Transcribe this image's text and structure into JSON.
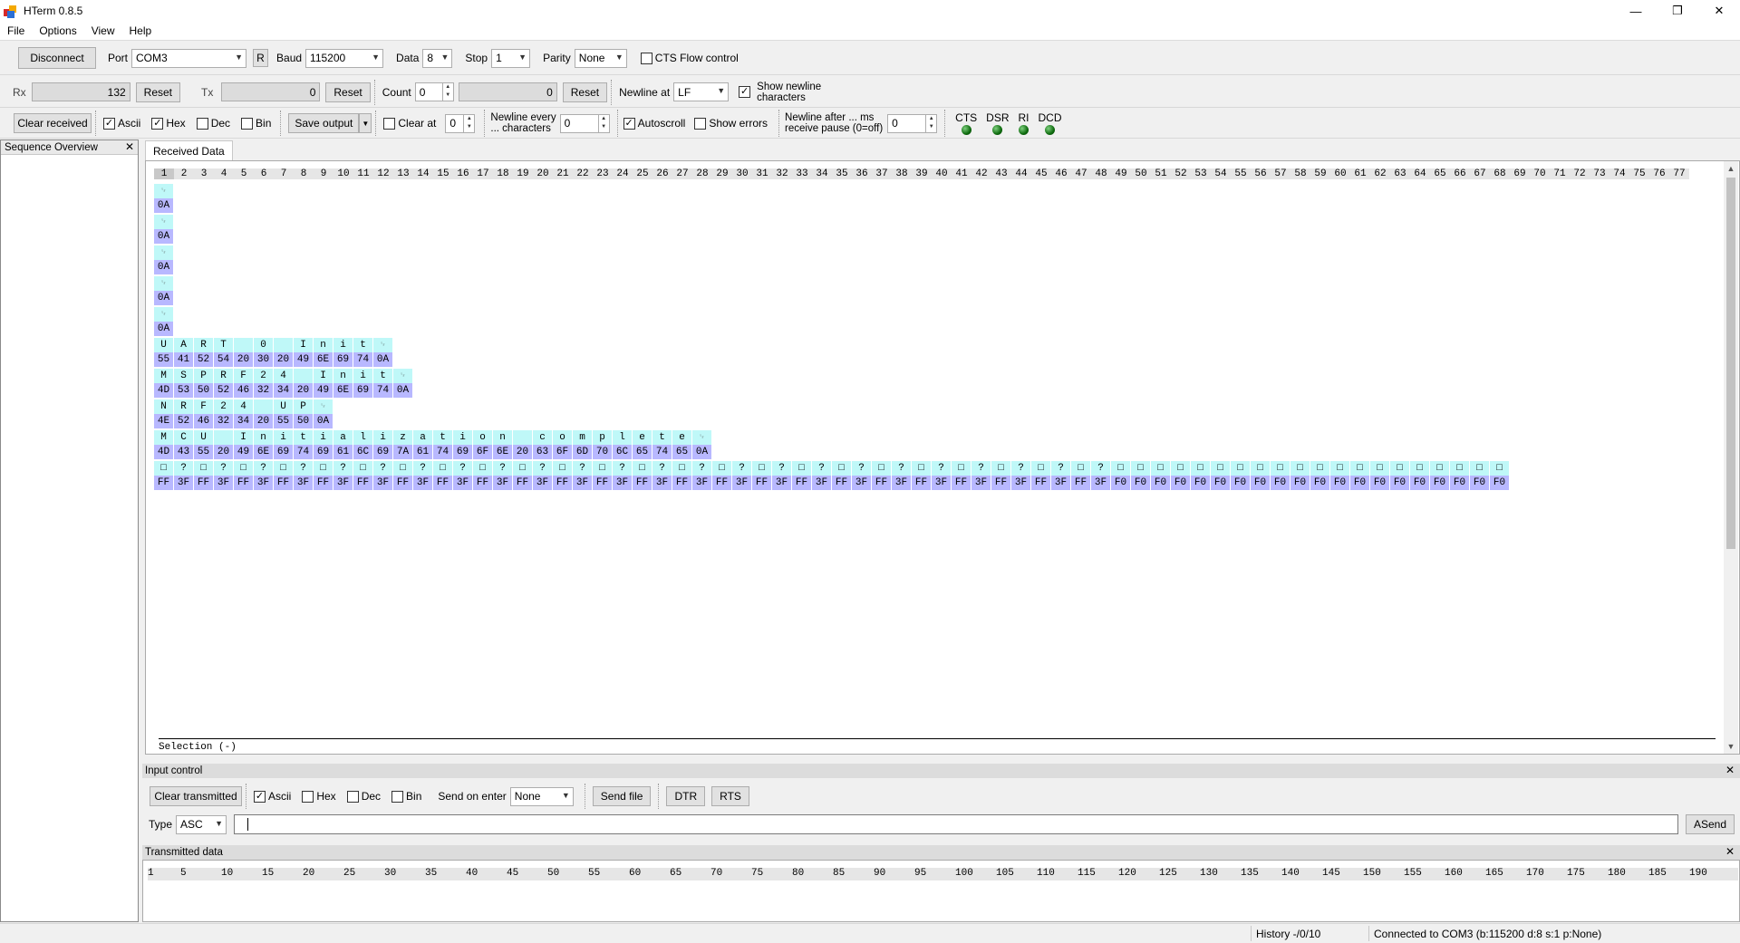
{
  "window": {
    "title": "HTerm 0.8.5"
  },
  "menu": [
    "File",
    "Options",
    "View",
    "Help"
  ],
  "connection": {
    "disconnect_label": "Disconnect",
    "port_label": "Port",
    "port_value": "COM3",
    "r_label": "R",
    "baud_label": "Baud",
    "baud_value": "115200",
    "data_label": "Data",
    "data_value": "8",
    "stop_label": "Stop",
    "stop_value": "1",
    "parity_label": "Parity",
    "parity_value": "None",
    "cts_label": "CTS Flow control"
  },
  "counters": {
    "rx_label": "Rx",
    "rx_value": "132",
    "rx_reset": "Reset",
    "tx_label": "Tx",
    "tx_value": "0",
    "tx_reset": "Reset",
    "count_label": "Count",
    "count_value": "0",
    "count_field": "0",
    "count_reset": "Reset",
    "newline_label": "Newline at",
    "newline_value": "LF",
    "show_newline_line1": "Show newline",
    "show_newline_line2": "characters"
  },
  "display": {
    "clear_received": "Clear received",
    "ascii": "Ascii",
    "hex": "Hex",
    "dec": "Dec",
    "bin": "Bin",
    "save_output": "Save output",
    "clear_at": "Clear at",
    "clear_at_value": "0",
    "newline_every_line1": "Newline every",
    "newline_every_line2": "... characters",
    "newline_every_value": "0",
    "autoscroll": "Autoscroll",
    "show_errors": "Show errors",
    "newline_after_line1": "Newline after ... ms",
    "newline_after_line2": "receive pause (0=off)",
    "newline_after_value": "0",
    "leds": [
      "CTS",
      "DSR",
      "RI",
      "DCD"
    ]
  },
  "sequence": {
    "title": "Sequence Overview"
  },
  "received": {
    "tab": "Received Data",
    "columns": 77,
    "newline_glyph": "␊",
    "rows": [
      {
        "ascii": [
          "␊"
        ],
        "hex": [
          "0A"
        ]
      },
      {
        "ascii": [
          "␊"
        ],
        "hex": [
          "0A"
        ]
      },
      {
        "ascii": [
          "␊"
        ],
        "hex": [
          "0A"
        ]
      },
      {
        "ascii": [
          "␊"
        ],
        "hex": [
          "0A"
        ]
      },
      {
        "ascii": [
          "␊"
        ],
        "hex": [
          "0A"
        ]
      },
      {
        "ascii": [
          "U",
          "A",
          "R",
          "T",
          " ",
          "0",
          " ",
          "I",
          "n",
          "i",
          "t",
          "␊"
        ],
        "hex": [
          "55",
          "41",
          "52",
          "54",
          "20",
          "30",
          "20",
          "49",
          "6E",
          "69",
          "74",
          "0A"
        ]
      },
      {
        "ascii": [
          "M",
          "S",
          "P",
          "R",
          "F",
          "2",
          "4",
          " ",
          "I",
          "n",
          "i",
          "t",
          "␊"
        ],
        "hex": [
          "4D",
          "53",
          "50",
          "52",
          "46",
          "32",
          "34",
          "20",
          "49",
          "6E",
          "69",
          "74",
          "0A"
        ]
      },
      {
        "ascii": [
          "N",
          "R",
          "F",
          "2",
          "4",
          " ",
          "U",
          "P",
          "␊"
        ],
        "hex": [
          "4E",
          "52",
          "46",
          "32",
          "34",
          "20",
          "55",
          "50",
          "0A"
        ]
      },
      {
        "ascii": [
          "M",
          "C",
          "U",
          " ",
          "I",
          "n",
          "i",
          "t",
          "i",
          "a",
          "l",
          "i",
          "z",
          "a",
          "t",
          "i",
          "o",
          "n",
          " ",
          "c",
          "o",
          "m",
          "p",
          "l",
          "e",
          "t",
          "e",
          "␊"
        ],
        "hex": [
          "4D",
          "43",
          "55",
          "20",
          "49",
          "6E",
          "69",
          "74",
          "69",
          "61",
          "6C",
          "69",
          "7A",
          "61",
          "74",
          "69",
          "6F",
          "6E",
          "20",
          "63",
          "6F",
          "6D",
          "70",
          "6C",
          "65",
          "74",
          "65",
          "0A"
        ]
      },
      {
        "ascii": [
          "□",
          "?",
          "□",
          "?",
          "□",
          "?",
          "□",
          "?",
          "□",
          "?",
          "□",
          "?",
          "□",
          "?",
          "□",
          "?",
          "□",
          "?",
          "□",
          "?",
          "□",
          "?",
          "□",
          "?",
          "□",
          "?",
          "□",
          "?",
          "□",
          "?",
          "□",
          "?",
          "□",
          "?",
          "□",
          "?",
          "□",
          "?",
          "□",
          "?",
          "□",
          "?",
          "□",
          "?",
          "□",
          "?",
          "□",
          "?",
          "□",
          "□",
          "□",
          "□",
          "□",
          "□",
          "□",
          "□",
          "□",
          "□",
          "□",
          "□",
          "□",
          "□",
          "□",
          "□",
          "□",
          "□",
          "□",
          "□"
        ],
        "hex": [
          "FF",
          "3F",
          "FF",
          "3F",
          "FF",
          "3F",
          "FF",
          "3F",
          "FF",
          "3F",
          "FF",
          "3F",
          "FF",
          "3F",
          "FF",
          "3F",
          "FF",
          "3F",
          "FF",
          "3F",
          "FF",
          "3F",
          "FF",
          "3F",
          "FF",
          "3F",
          "FF",
          "3F",
          "FF",
          "3F",
          "FF",
          "3F",
          "FF",
          "3F",
          "FF",
          "3F",
          "FF",
          "3F",
          "FF",
          "3F",
          "FF",
          "3F",
          "FF",
          "3F",
          "FF",
          "3F",
          "FF",
          "3F",
          "F0",
          "F0",
          "F0",
          "F0",
          "F0",
          "F0",
          "F0",
          "F0",
          "F0",
          "F0",
          "F0",
          "F0",
          "F0",
          "F0",
          "F0",
          "F0",
          "F0",
          "F0",
          "F0",
          "F0"
        ]
      }
    ],
    "selection": "Selection (-)"
  },
  "input_control": {
    "title": "Input control",
    "clear_transmitted": "Clear transmitted",
    "ascii": "Ascii",
    "hex": "Hex",
    "dec": "Dec",
    "bin": "Bin",
    "send_on_enter_label": "Send on enter",
    "send_on_enter_value": "None",
    "send_file": "Send file",
    "dtr": "DTR",
    "rts": "RTS",
    "type_label": "Type",
    "type_value": "ASC",
    "send_input_value": "",
    "asend": "ASend"
  },
  "transmitted": {
    "title": "Transmitted data",
    "column_marks": [
      "1",
      "5",
      "10",
      "15",
      "20",
      "25",
      "30",
      "35",
      "40",
      "45",
      "50",
      "55",
      "60",
      "65",
      "70",
      "75",
      "80",
      "85",
      "90",
      "95",
      "100",
      "105",
      "110",
      "115",
      "120",
      "125",
      "130",
      "135",
      "140",
      "145",
      "150",
      "155",
      "160",
      "165",
      "170",
      "175",
      "180",
      "185",
      "190"
    ]
  },
  "status": {
    "history": "History -/0/10",
    "connection": "Connected to COM3 (b:115200 d:8 s:1 p:None)"
  }
}
